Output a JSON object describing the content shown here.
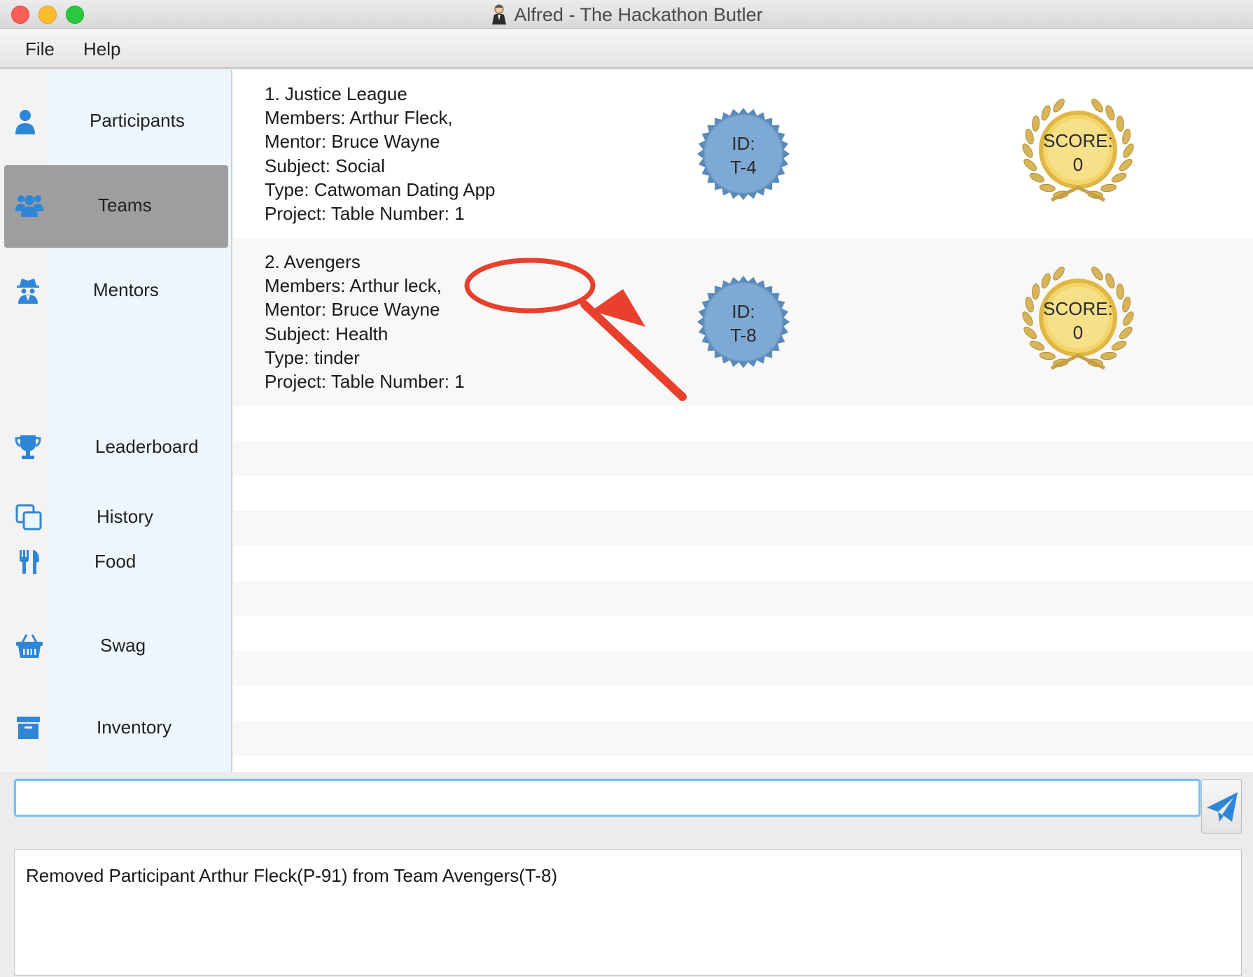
{
  "window": {
    "title": "Alfred - The Hackathon Butler"
  },
  "menu": {
    "file": "File",
    "help": "Help"
  },
  "sidebar": {
    "items": [
      {
        "label": "Participants",
        "icon": "user-icon",
        "active": false
      },
      {
        "label": "Teams",
        "icon": "users-icon",
        "active": true
      },
      {
        "label": "Mentors",
        "icon": "spy-icon",
        "active": false
      },
      {
        "label": "Leaderboard",
        "icon": "trophy-icon",
        "active": false
      },
      {
        "label": "History",
        "icon": "copy-icon",
        "active": false
      },
      {
        "label": "Food",
        "icon": "utensils-icon",
        "active": false
      },
      {
        "label": "Swag",
        "icon": "basket-icon",
        "active": false
      },
      {
        "label": "Inventory",
        "icon": "archive-icon",
        "active": false
      }
    ]
  },
  "teams": [
    {
      "header": "1.  Justice League",
      "members": "Members: Arthur Fleck,",
      "mentor": "Mentor: Bruce Wayne",
      "subject": "Subject: Social",
      "type": "Type: Catwoman Dating App",
      "project": "Project:  Table Number: 1",
      "id_label": "ID:",
      "id_value": "T-4",
      "score_label": "SCORE:",
      "score_value": "0"
    },
    {
      "header": "2.  Avengers",
      "members": "Members: Arthur leck,",
      "mentor": "Mentor: Bruce Wayne",
      "subject": "Subject: Health",
      "type": "Type: tinder",
      "project": "Project:  Table Number: 1",
      "id_label": "ID:",
      "id_value": "T-8",
      "score_label": "SCORE:",
      "score_value": "0"
    }
  ],
  "command": {
    "value": "",
    "placeholder": ""
  },
  "result": {
    "text": "Removed Participant Arthur Fleck(P-91) from Team Avengers(T-8)"
  },
  "colors": {
    "icon_blue": "#2f86d6",
    "active_nav": "#9e9e9e",
    "id_badge": "#7ea9d4",
    "annotation_red": "#e8402c",
    "input_border": "#7fbfec"
  }
}
